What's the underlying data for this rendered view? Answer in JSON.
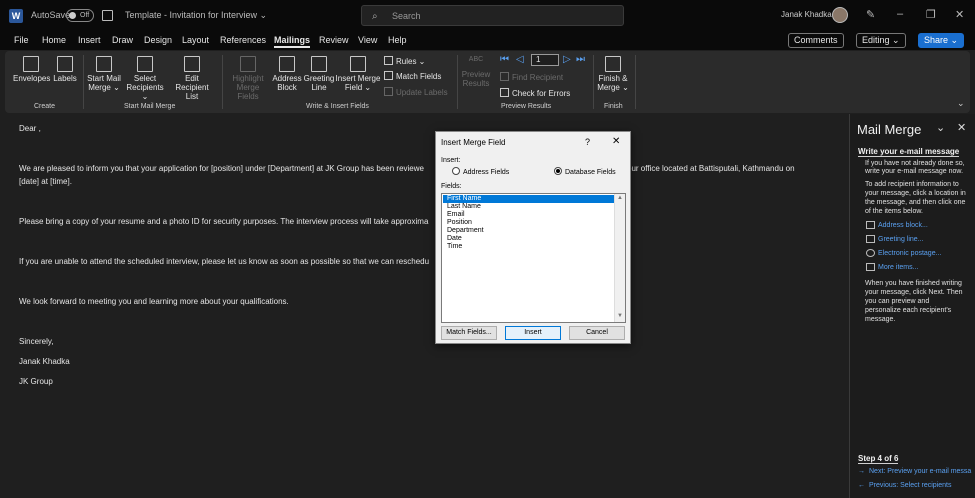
{
  "titlebar": {
    "app_letter": "W",
    "autosave_label": "AutoSave",
    "autosave_state": "Off",
    "doc_title": "Template - Invitation for Interview ⌄",
    "search_placeholder": "Search",
    "user_name": "Janak Khadka"
  },
  "menu": {
    "items": [
      "File",
      "Home",
      "Insert",
      "Draw",
      "Design",
      "Layout",
      "References",
      "Mailings",
      "Review",
      "View",
      "Help"
    ],
    "active": "Mailings",
    "comments": "Comments",
    "editing": "Editing ⌄",
    "share": "Share ⌄"
  },
  "ribbon": {
    "create": {
      "label": "Create",
      "envelopes": "Envelopes",
      "labels": "Labels"
    },
    "start": {
      "label": "Start Mail Merge",
      "start_mail_merge": [
        "Start Mail",
        "Merge ⌄"
      ],
      "select_recipients": [
        "Select",
        "Recipients ⌄"
      ],
      "edit_list": [
        "Edit",
        "Recipient List"
      ]
    },
    "write": {
      "label": "Write & Insert Fields",
      "highlight": [
        "Highlight",
        "Merge Fields"
      ],
      "address_block": [
        "Address",
        "Block"
      ],
      "greeting_line": [
        "Greeting",
        "Line"
      ],
      "insert_merge_field": [
        "Insert Merge",
        "Field ⌄"
      ],
      "rules": "Rules ⌄",
      "match_fields": "Match Fields",
      "update_labels": "Update Labels"
    },
    "preview": {
      "label": "Preview Results",
      "preview_results": [
        "Preview",
        "Results"
      ],
      "abc": "ABC",
      "record": "1",
      "find_recipient": "Find Recipient",
      "check_errors": "Check for Errors"
    },
    "finish": {
      "label": "Finish",
      "finish_merge": [
        "Finish &",
        "Merge ⌄"
      ]
    }
  },
  "document": {
    "lines": [
      "Dear ,",
      "We are pleased to inform you that your application for [position] under [Department] at JK Group has been reviewe",
      "our office located at Battisputali, Kathmandu on",
      "[date] at [time].",
      "Please bring a copy of your resume and a photo ID for security purposes. The interview process will take approxima",
      "If you are unable to attend the scheduled interview, please let us know as soon as possible so that we can reschedu",
      "We look forward to meeting you and learning more about your qualifications.",
      "Sincerely,",
      "Janak Khadka",
      "JK Group"
    ]
  },
  "dialog": {
    "title": "Insert Merge Field",
    "help": "?",
    "close": "✕",
    "insert_label": "Insert:",
    "address_fields": "Address Fields",
    "database_fields": "Database Fields",
    "selected_mode": "database",
    "fields_label": "Fields:",
    "fields": [
      "First Name",
      "Last Name",
      "Email",
      "Position",
      "Department",
      "Date",
      "Time"
    ],
    "selected_field": "First Name",
    "match_fields_btn": "Match Fields...",
    "insert_btn": "Insert",
    "cancel_btn": "Cancel"
  },
  "pane": {
    "title": "Mail Merge",
    "heading": "Write your e-mail message",
    "intro": [
      "If you have not already done so,",
      "write your e-mail message now."
    ],
    "instructions": [
      "To add recipient information to",
      "your message, click a location in",
      "the message, and then click one",
      "of the items below."
    ],
    "links": [
      "Address block...",
      "Greeting line...",
      "Electronic postage...",
      "More items..."
    ],
    "finish_text": [
      "When you have finished writing",
      "your message, click Next. Then",
      "you can preview and",
      "personalize each recipient's",
      "message."
    ],
    "step": "Step 4 of 6",
    "next": "Next: Preview your e-mail messa",
    "previous": "Previous: Select recipients"
  },
  "colors": {
    "accent": "#1a6fd0",
    "link": "#5aa0f0",
    "selection": "#0078d7"
  }
}
